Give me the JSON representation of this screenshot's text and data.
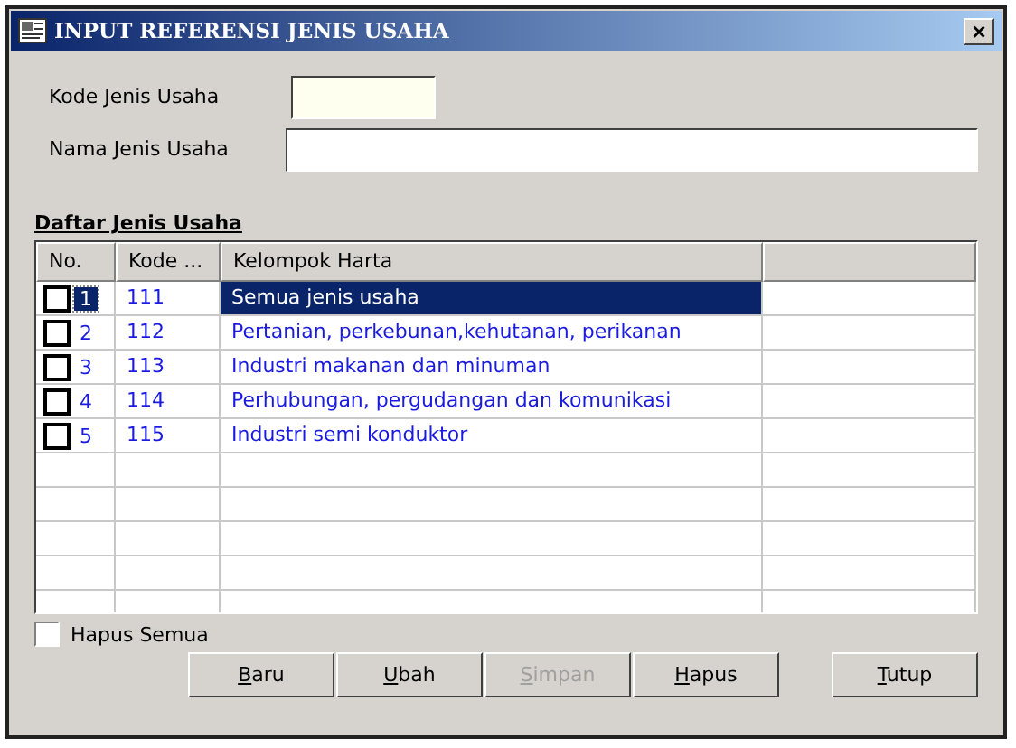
{
  "window": {
    "title": "INPUT REFERENSI JENIS USAHA",
    "close": "×"
  },
  "fields": [
    {
      "label": "Kode Jenis Usaha",
      "kind": "short"
    },
    {
      "label": "Nama Jenis Usaha",
      "kind": "long"
    }
  ],
  "list_title": "Daftar Jenis Usaha",
  "table": {
    "columns": [
      "No.",
      "Kode ...",
      "Kelompok Harta"
    ],
    "rows": [
      {
        "no": "1",
        "kode": "111",
        "kelompok": "Semua jenis usaha",
        "checked": false,
        "selected": true
      },
      {
        "no": "2",
        "kode": "112",
        "kelompok": "Pertanian, perkebunan,kehutanan, perikanan",
        "checked": false,
        "selected": false
      },
      {
        "no": "3",
        "kode": "113",
        "kelompok": "Industri makanan dan minuman",
        "checked": false,
        "selected": false
      },
      {
        "no": "4",
        "kode": "114",
        "kelompok": "Perhubungan, pergudangan dan komunikasi",
        "checked": false,
        "selected": false
      },
      {
        "no": "5",
        "kode": "115",
        "kelompok": "Industri semi konduktor",
        "checked": false,
        "selected": false
      }
    ]
  },
  "hapus_semua": {
    "label": "Hapus Semua",
    "checked": false
  },
  "buttons": [
    {
      "label": "Baru",
      "disabled": false
    },
    {
      "label": "Ubah",
      "disabled": false
    },
    {
      "label": "Simpan",
      "disabled": true
    },
    {
      "label": "Hapus",
      "disabled": false
    },
    {
      "label": "Tutup",
      "disabled": false
    }
  ]
}
